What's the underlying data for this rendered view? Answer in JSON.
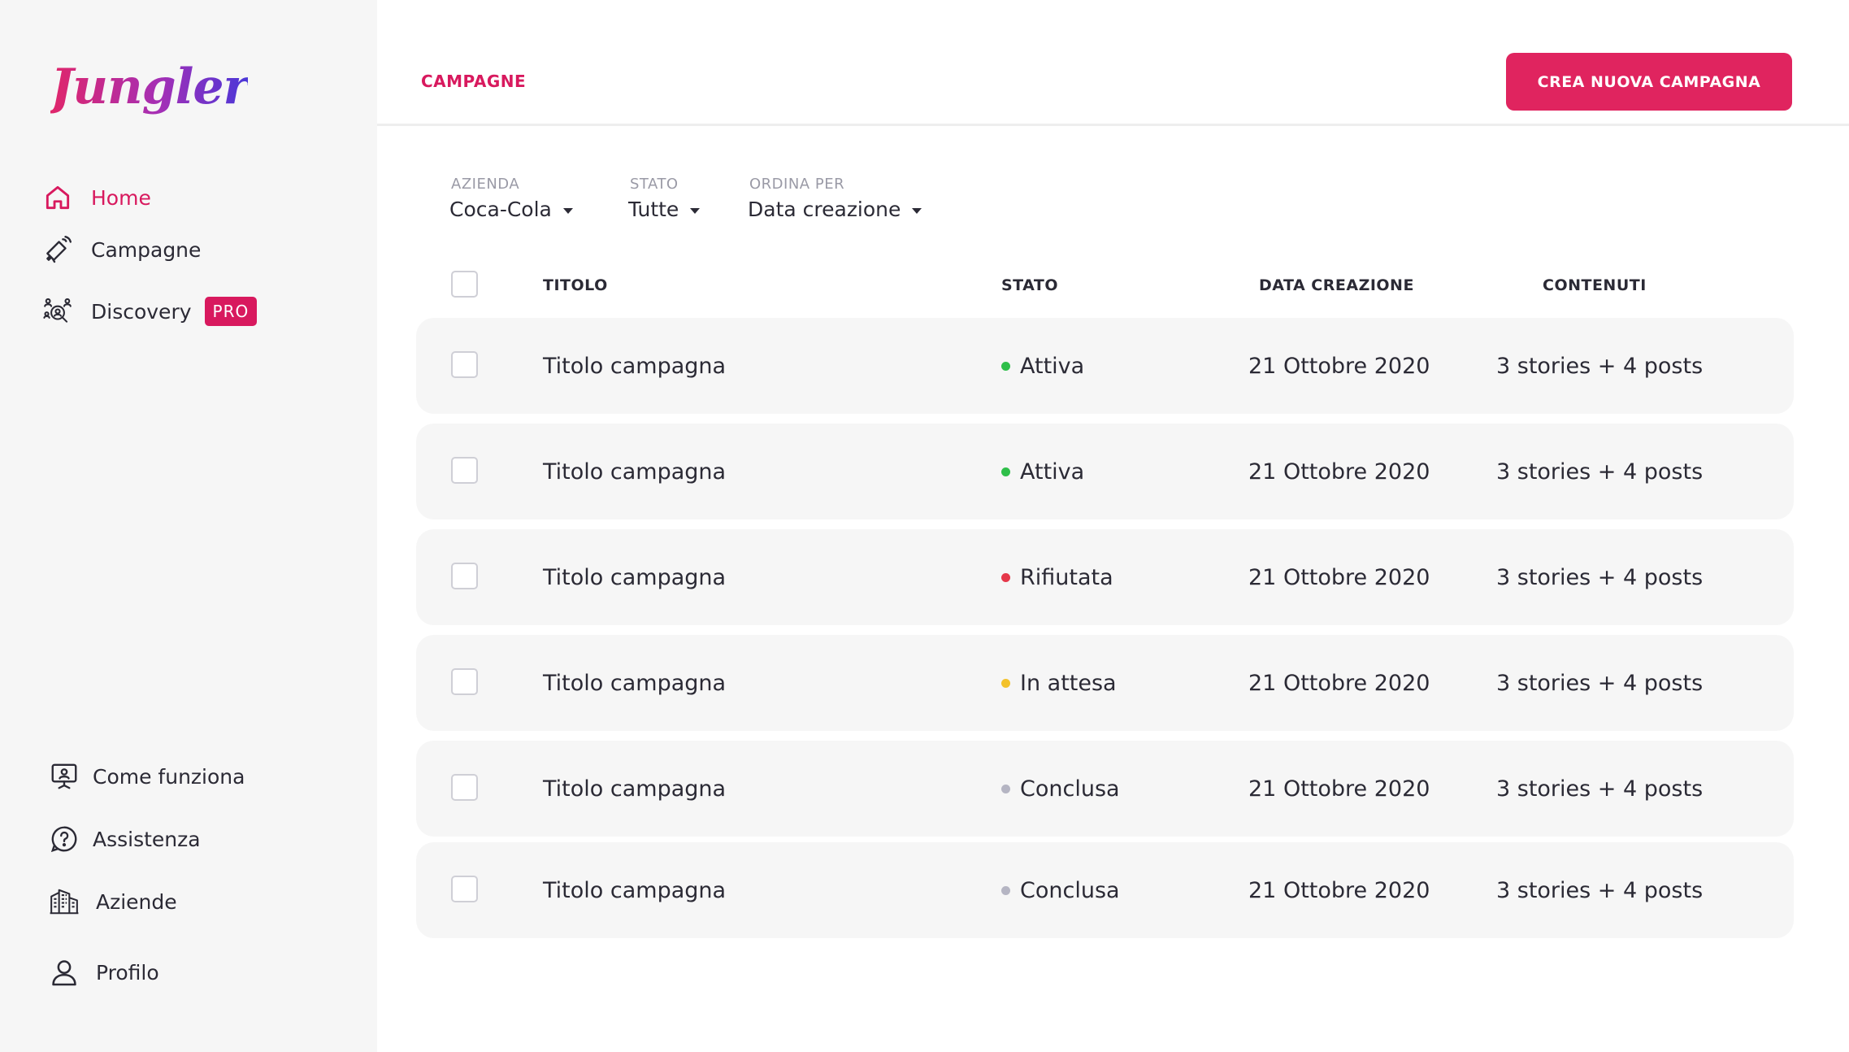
{
  "app": {
    "logo_text": "Jungler",
    "brand_color": "#d8195e"
  },
  "sidebar": {
    "top_items": [
      {
        "label": "Home",
        "icon": "home-icon",
        "active": true
      },
      {
        "label": "Campagne",
        "icon": "megaphone-icon",
        "active": false
      },
      {
        "label": "Discovery",
        "icon": "discovery-people-icon",
        "active": false,
        "badge": "PRO"
      }
    ],
    "bottom_items": [
      {
        "label": "Come funziona",
        "icon": "presentation-icon"
      },
      {
        "label": "Assistenza",
        "icon": "help-circle-icon"
      },
      {
        "label": "Aziende",
        "icon": "building-icon"
      },
      {
        "label": "Profilo",
        "icon": "user-icon"
      }
    ]
  },
  "header": {
    "breadcrumb": "CAMPAGNE",
    "create_button": "CREA NUOVA CAMPAGNA"
  },
  "filters": [
    {
      "label": "AZIENDA",
      "value": "Coca-Cola"
    },
    {
      "label": "STATO",
      "value": "Tutte"
    },
    {
      "label": "ORDINA PER",
      "value": "Data creazione"
    }
  ],
  "table": {
    "columns": [
      "TITOLO",
      "STATO",
      "DATA CREAZIONE",
      "CONTENUTI"
    ],
    "rows": [
      {
        "title": "Titolo campagna",
        "status": "Attiva",
        "status_color": "#2fbf4a",
        "date": "21 Ottobre 2020",
        "contents": "3 stories + 4 posts"
      },
      {
        "title": "Titolo campagna",
        "status": "Attiva",
        "status_color": "#2fbf4a",
        "date": "21 Ottobre 2020",
        "contents": "3 stories + 4 posts"
      },
      {
        "title": "Titolo campagna",
        "status": "Rifiutata",
        "status_color": "#e5384a",
        "date": "21 Ottobre 2020",
        "contents": "3 stories + 4 posts"
      },
      {
        "title": "Titolo campagna",
        "status": "In attesa",
        "status_color": "#f3c22b",
        "date": "21 Ottobre 2020",
        "contents": "3 stories + 4 posts"
      },
      {
        "title": "Titolo campagna",
        "status": "Conclusa",
        "status_color": "#b5b5c3",
        "date": "21 Ottobre 2020",
        "contents": "3 stories + 4 posts"
      },
      {
        "title": "Titolo campagna",
        "status": "Conclusa",
        "status_color": "#b5b5c3",
        "date": "21 Ottobre 2020",
        "contents": "3 stories + 4 posts"
      }
    ]
  }
}
